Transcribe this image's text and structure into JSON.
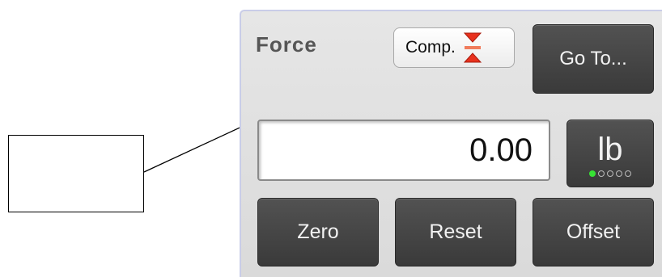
{
  "panel": {
    "title": "Force",
    "mode_button": {
      "label": "Comp.",
      "icon": "compression-arrows-icon",
      "icon_color": "#e8321e"
    },
    "goto_label": "Go To...",
    "reading": "0.00",
    "unit": {
      "label": "lb",
      "options_count": 5,
      "selected_index": 0,
      "indicator_color": "#37e234"
    },
    "buttons": {
      "zero": "Zero",
      "reset": "Reset",
      "offset": "Offset"
    }
  }
}
